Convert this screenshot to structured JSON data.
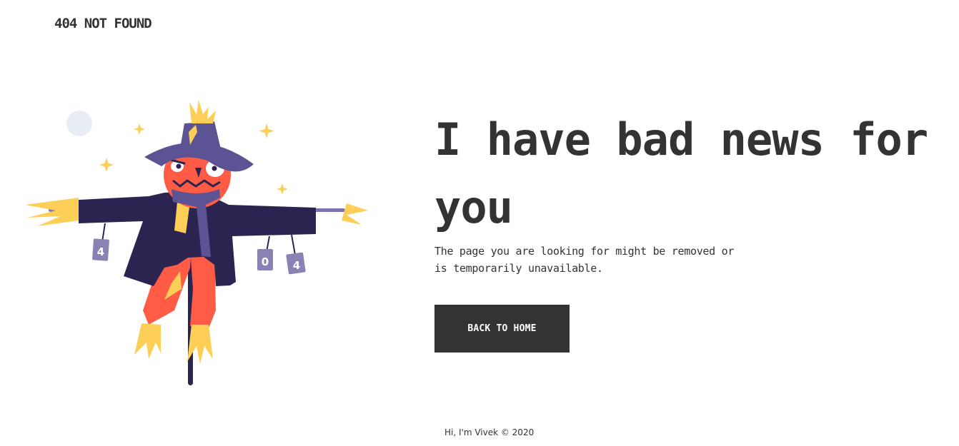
{
  "header": {
    "brand": "404 NOT FOUND"
  },
  "main": {
    "headline": "I have bad news for you",
    "subtext": "The page you are looking for might be removed or is temporarily unavailable.",
    "back_button_label": "BACK TO HOME"
  },
  "illustration": {
    "subject": "scarecrow",
    "can_labels": [
      "4",
      "0",
      "4"
    ]
  },
  "footer": {
    "text": "Hi, I'm Vivek © 2020"
  },
  "colors": {
    "text": "#333333",
    "button_bg": "#333333",
    "button_text": "#ffffff",
    "hat": "#5b5394",
    "coat": "#2b2450",
    "face": "#ff5b45",
    "straw": "#fecf57",
    "cans": "#8a82b4",
    "moon": "#e8edf5"
  }
}
